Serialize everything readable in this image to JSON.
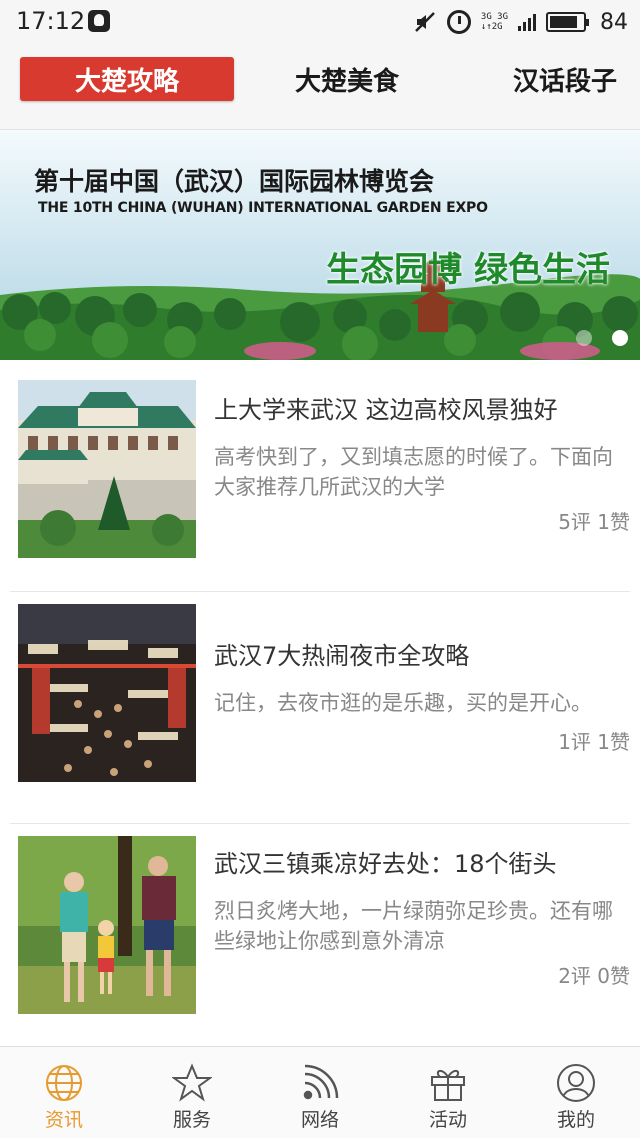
{
  "status_bar": {
    "time": "17:12",
    "network_top": "3G 3G",
    "network_bottom": "↓↑2G",
    "battery_level": 0.84,
    "battery_percent": "84"
  },
  "tabs": [
    {
      "label": "大楚攻略",
      "active": true
    },
    {
      "label": "大楚美食",
      "active": false
    },
    {
      "label": "汉话段子",
      "active": false
    }
  ],
  "banner": {
    "title": "第十届中国（武汉）国际园林博览会",
    "subtitle": "THE 10TH CHINA (WUHAN) INTERNATIONAL GARDEN EXPO",
    "slogan": "生态园博  绿色生活",
    "slide_count": 2,
    "active_slide": 1
  },
  "articles": [
    {
      "title": "上大学来武汉 这边高校风景独好",
      "summary": "高考快到了，又到填志愿的时候了。下面向大家推荐几所武汉的大学",
      "stats": "5评 1赞",
      "thumbnail": "campus-building"
    },
    {
      "title": "武汉7大热闹夜市全攻略",
      "summary": "记住，去夜市逛的是乐趣，买的是开心。",
      "stats": "1评 1赞",
      "thumbnail": "night-market"
    },
    {
      "title": "武汉三镇乘凉好去处：18个街头",
      "summary": "烈日炙烤大地，一片绿荫弥足珍贵。还有哪些绿地让你感到意外清凉",
      "stats": "2评 0赞",
      "thumbnail": "family-in-park"
    }
  ],
  "bottom_nav": [
    {
      "label": "资讯",
      "icon": "globe-icon",
      "active": true
    },
    {
      "label": "服务",
      "icon": "star-icon",
      "active": false
    },
    {
      "label": "网络",
      "icon": "rss-icon",
      "active": false
    },
    {
      "label": "活动",
      "icon": "gift-icon",
      "active": false
    },
    {
      "label": "我的",
      "icon": "user-icon",
      "active": false
    }
  ],
  "colors": {
    "accent_red": "#d83a30",
    "active_nav": "#e79a2f",
    "text_primary": "#333333",
    "text_secondary": "#888888"
  }
}
